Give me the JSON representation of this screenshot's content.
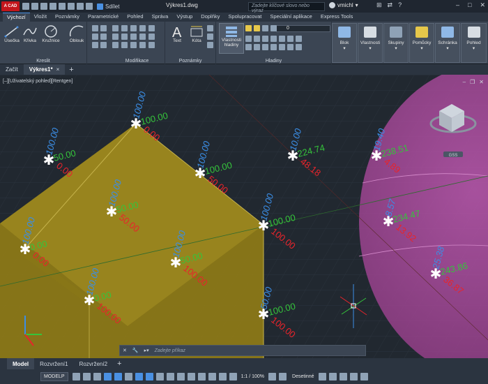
{
  "titlebar": {
    "logo": "A CAD",
    "share_label": "Sdílet",
    "document_title": "Výkres1.dwg",
    "search_placeholder": "Zadejte klíčové slovo nebo výraz",
    "user_name": "vmichl"
  },
  "ribbon_tabs": [
    "Výchozí",
    "Vložit",
    "Poznámky",
    "Parametrické",
    "Pohled",
    "Správa",
    "Výstup",
    "Doplňky",
    "Spolupracovat",
    "Speciální aplikace",
    "Express Tools"
  ],
  "ribbon": {
    "draw": {
      "label": "Kreslit",
      "tools": [
        "Úsečka",
        "Křivka",
        "Kružnice",
        "Oblouk"
      ]
    },
    "modify_label": "Modifikace",
    "annotation": {
      "label": "Poznámky",
      "tools": [
        "Text",
        "Kóta"
      ]
    },
    "layers": {
      "label": "Hladiny",
      "properties_button": "Vlastnosti hladiny",
      "current_layer": "0"
    },
    "right_tools": [
      "Blok",
      "Vlastnosti",
      "Skupiny",
      "Pomůcky",
      "Schránka",
      "Pohled"
    ]
  },
  "doc_tabs": {
    "start": "Začít",
    "active": "Výkres1*"
  },
  "viewport": {
    "label": "[–][Uživatelský pohled][Rentgen]",
    "viewcube_label": "GSS"
  },
  "markers": [
    {
      "blue": "100.00",
      "green": "50.00",
      "red": "0.00"
    },
    {
      "blue": "100.00",
      "green": "100.00",
      "red": "0.00"
    },
    {
      "blue": "100.00",
      "green": "100.00",
      "red": "50.00"
    },
    {
      "blue": "100.00",
      "green": "50.00",
      "red": "50.00"
    },
    {
      "blue": "100.00",
      "green": "100.00",
      "red": "100.00"
    },
    {
      "blue": "100.00",
      "green": "0.00",
      "red": "0.00"
    },
    {
      "blue": "100.00",
      "green": "50.00",
      "red": "100.00"
    },
    {
      "blue": "100.00",
      "green": "0.00",
      "red": "100.00"
    },
    {
      "blue": "50.00",
      "green": "100.00",
      "red": "100.00"
    },
    {
      "blue": "10.00",
      "green": "224.74",
      "red": "48.18"
    },
    {
      "blue": "19.40",
      "green": "238.51",
      "red": "4.89"
    },
    {
      "blue": "8.57",
      "green": "234.47",
      "red": "13.92"
    },
    {
      "blue": "25.38",
      "green": "243.86",
      "red": "36.87"
    }
  ],
  "command_line": {
    "placeholder": "Zadejte příkaz"
  },
  "layout_tabs": [
    "Model",
    "Rozvržení1",
    "Rozvržení2"
  ],
  "statusbar": {
    "space": "MODELP",
    "scale": "1:1 / 100%",
    "units": "Desetinné"
  },
  "colors": {
    "background": "#212830",
    "cube_face": "#8f7b17",
    "sphere": "#b34ea6",
    "blue_label": "#3b8ee6",
    "green_label": "#35c43b",
    "red_label": "#e8242b"
  }
}
